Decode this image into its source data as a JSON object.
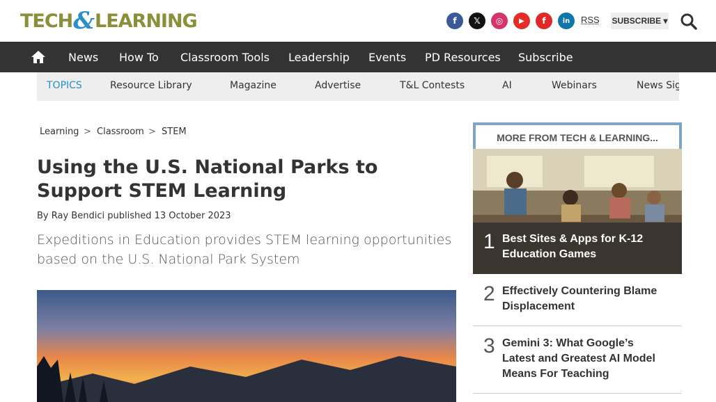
{
  "logo": {
    "part1": "TECH",
    "amp": "&",
    "part2": "LEARNING"
  },
  "social": [
    {
      "name": "facebook-icon",
      "glyph": "f",
      "color": "#3b5998"
    },
    {
      "name": "x-icon",
      "glyph": "𝕏",
      "color": "#111111"
    },
    {
      "name": "instagram-icon",
      "glyph": "◎",
      "color": "#d6336c"
    },
    {
      "name": "youtube-icon",
      "glyph": "▶",
      "color": "#e52d27"
    },
    {
      "name": "flipboard-icon",
      "glyph": "f",
      "color": "#e12828"
    },
    {
      "name": "linkedin-icon",
      "glyph": "in",
      "color": "#0e76a8"
    }
  ],
  "header": {
    "rss": "RSS",
    "subscribe": "SUBSCRIBE ▾"
  },
  "nav": [
    "News",
    "How To",
    "Classroom Tools",
    "Leadership",
    "Events",
    "PD Resources",
    "Subscribe"
  ],
  "topics": {
    "label": "TOPICS",
    "items": [
      "Resource Library",
      "Magazine",
      "Advertise",
      "T&L Contests",
      "AI",
      "Webinars",
      "News Sig"
    ]
  },
  "breadcrumb": {
    "items": [
      "Learning",
      "Classroom",
      "STEM"
    ],
    "sep": ">"
  },
  "article": {
    "title": "Using the U.S. National Parks to Support STEM Learning",
    "by": "By",
    "author": "Ray Bendici",
    "published": "published 13 October 2023",
    "strapline": "Expeditions in Education provides STEM learning opportunities based on the U.S. National Park System"
  },
  "sidebar": {
    "heading": "MORE FROM TECH & LEARNING...",
    "items": [
      {
        "num": "1",
        "title": "Best Sites & Apps for K-12 Education Games"
      },
      {
        "num": "2",
        "title": "Effectively Countering Blame Displacement"
      },
      {
        "num": "3",
        "title": "Gemini 3: What Google’s Latest and Greatest AI Model Means For Teaching"
      }
    ]
  }
}
